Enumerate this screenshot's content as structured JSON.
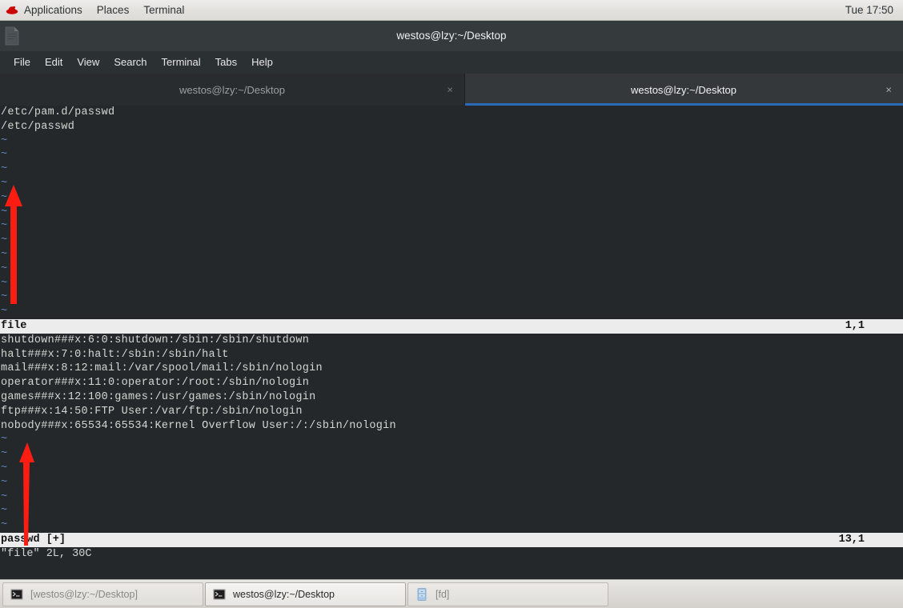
{
  "top_panel": {
    "logo_icon": "redhat-logo-icon",
    "menus": [
      "Applications",
      "Places",
      "Terminal"
    ],
    "clock": "Tue 17:50"
  },
  "window": {
    "icon": "document-icon",
    "title": "westos@lzy:~/Desktop"
  },
  "menubar": {
    "items": [
      "File",
      "Edit",
      "View",
      "Search",
      "Terminal",
      "Tabs",
      "Help"
    ]
  },
  "tabs": [
    {
      "label": "westos@lzy:~/Desktop",
      "active": false,
      "close_icon": "×"
    },
    {
      "label": "westos@lzy:~/Desktop",
      "active": true,
      "close_icon": "×"
    }
  ],
  "terminal": {
    "top_pane": {
      "lines": [
        "/etc/pam.d/passwd",
        "/etc/passwd"
      ],
      "tildes": [
        "~",
        "~",
        "~",
        "~",
        "~",
        "~",
        "~",
        "~",
        "~",
        "~",
        "~",
        "~",
        "~"
      ],
      "status_name": "file",
      "status_rowcol": "1,1"
    },
    "bottom_pane": {
      "lines": [
        "shutdown###x:6:0:shutdown:/sbin:/sbin/shutdown",
        "halt###x:7:0:halt:/sbin:/sbin/halt",
        "mail###x:8:12:mail:/var/spool/mail:/sbin/nologin",
        "operator###x:11:0:operator:/root:/sbin/nologin",
        "games###x:12:100:games:/usr/games:/sbin/nologin",
        "ftp###x:14:50:FTP User:/var/ftp:/sbin/nologin",
        "nobody###x:65534:65534:Kernel Overflow User:/:/sbin/nologin"
      ],
      "tildes": [
        "~",
        "~",
        "~",
        "~",
        "~",
        "~",
        "~"
      ],
      "status_name": "passwd [+]",
      "status_rowcol": "13,1"
    },
    "command_line": "\"file\" 2L, 30C"
  },
  "annotations": [
    {
      "name": "red-arrow-up-top",
      "color": "#fb1d12"
    },
    {
      "name": "red-arrow-up-bottom",
      "color": "#fb1d12"
    }
  ],
  "taskbar": {
    "buttons": [
      {
        "label": "[westos@lzy:~/Desktop]",
        "icon": "terminal-icon",
        "state": "minimized"
      },
      {
        "label": "westos@lzy:~/Desktop",
        "icon": "terminal-icon",
        "state": "active"
      },
      {
        "label": "[fd]",
        "icon": "file-manager-icon",
        "state": "minimized"
      }
    ]
  },
  "colors": {
    "terminal_bg": "#24282b",
    "terminal_fg": "#d3d7d1",
    "tilde_blue": "#5f87bf",
    "tab_accent": "#2a6ab8",
    "status_bg": "#ececec",
    "arrow_red": "#fb1d12"
  }
}
